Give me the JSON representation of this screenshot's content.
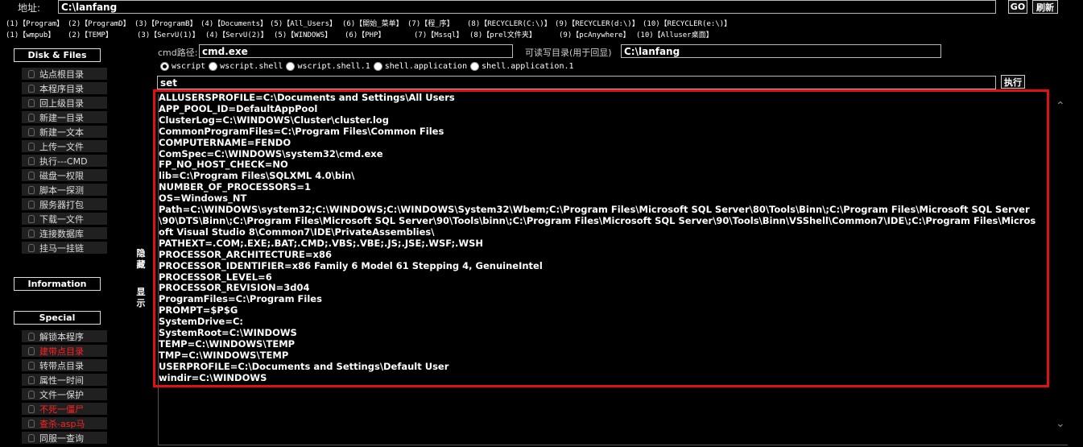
{
  "address": {
    "label": "地址:",
    "value": "C:\\lanfang",
    "go": "GO",
    "refresh": "刷新"
  },
  "quick_links_row1": [
    "(1)【Program】",
    "(2)【ProgramD】",
    "(3)【ProgramB】",
    "(4)【Documents】",
    "(5)【All_Users】",
    "(6)【開始_菜单】",
    "(7)【程_序】",
    "(8)【RECYCLER(C:\\)】",
    "(9)【RECYCLER(d:\\)】",
    "(10)【RECYCLER(e:\\)】"
  ],
  "quick_links_row2": [
    "(1)【wmpub】",
    "(2)【TEMP】",
    "(3)【ServU(1)】",
    "(4)【ServU(2)】",
    "(5)【WINDOWS】",
    "(6)【PHP】",
    "(7)【Mssql】",
    "(8)【prel文件夹】",
    "(9)【pcAnywhere】",
    "(10)【Alluser桌面】"
  ],
  "sidebar": {
    "disk_header": "Disk & Files",
    "disk_items": [
      {
        "label": "站点根目录",
        "red": false
      },
      {
        "label": "本程序目录",
        "red": false
      },
      {
        "label": "回上级目录",
        "red": false
      },
      {
        "label": "新建一目录",
        "red": false
      },
      {
        "label": "新建一文本",
        "red": false
      },
      {
        "label": "上传一文件",
        "red": false
      },
      {
        "label": "执行---CMD",
        "red": false
      },
      {
        "label": "磁盘一权限",
        "red": false
      },
      {
        "label": "脚本一探测",
        "red": false
      },
      {
        "label": "服务器打包",
        "red": false
      },
      {
        "label": "下载一文件",
        "red": false
      },
      {
        "label": "连接数据库",
        "red": false
      },
      {
        "label": "挂马一挂链",
        "red": false
      }
    ],
    "info_header": "Information",
    "special_header": "Special",
    "special_items": [
      {
        "label": "解锁本程序",
        "red": false
      },
      {
        "label": "建带点目录",
        "red": true
      },
      {
        "label": "转带点目录",
        "red": false
      },
      {
        "label": "属性一时间",
        "red": false
      },
      {
        "label": "文件一保护",
        "red": false
      },
      {
        "label": "不死一僵尸",
        "red": true
      },
      {
        "label": "查杀-asp马",
        "red": true
      },
      {
        "label": "同服一查询",
        "red": false
      }
    ],
    "toggle_hide": "隐藏",
    "toggle_show": "显示"
  },
  "cmd": {
    "path_label": "cmd路径:",
    "path_value": "cmd.exe",
    "writable_label": "可读写目录(用于回显)",
    "writable_value": "C:\\lanfang",
    "methods": [
      {
        "label": "wscript",
        "checked": true
      },
      {
        "label": "wscript.shell",
        "checked": false
      },
      {
        "label": "wscript.shell.1",
        "checked": false
      },
      {
        "label": "shell.application",
        "checked": false
      },
      {
        "label": "shell.application.1",
        "checked": false
      }
    ],
    "command_value": "set",
    "execute": "执行"
  },
  "output_lines": [
    "ALLUSERSPROFILE=C:\\Documents and Settings\\All Users",
    "APP_POOL_ID=DefaultAppPool",
    "ClusterLog=C:\\WINDOWS\\Cluster\\cluster.log",
    "CommonProgramFiles=C:\\Program Files\\Common Files",
    "COMPUTERNAME=FENDO",
    "ComSpec=C:\\WINDOWS\\system32\\cmd.exe",
    "FP_NO_HOST_CHECK=NO",
    "lib=C:\\Program Files\\SQLXML 4.0\\bin\\",
    "NUMBER_OF_PROCESSORS=1",
    "OS=Windows_NT",
    "Path=C:\\WINDOWS\\system32;C:\\WINDOWS;C:\\WINDOWS\\System32\\Wbem;C:\\Program Files\\Microsoft SQL Server\\80\\Tools\\Binn\\;C:\\Program Files\\Microsoft SQL Server\\90\\DTS\\Binn\\;C:\\Program Files\\Microsoft SQL Server\\90\\Tools\\binn\\;C:\\Program Files\\Microsoft SQL Server\\90\\Tools\\Binn\\VSShell\\Common7\\IDE\\;C:\\Program Files\\Microsoft Visual Studio 8\\Common7\\IDE\\PrivateAssemblies\\",
    "PATHEXT=.COM;.EXE;.BAT;.CMD;.VBS;.VBE;.JS;.JSE;.WSF;.WSH",
    "PROCESSOR_ARCHITECTURE=x86",
    "PROCESSOR_IDENTIFIER=x86 Family 6 Model 61 Stepping 4, GenuineIntel",
    "PROCESSOR_LEVEL=6",
    "PROCESSOR_REVISION=3d04",
    "ProgramFiles=C:\\Program Files",
    "PROMPT=$P$G",
    "SystemDrive=C:",
    "SystemRoot=C:\\WINDOWS",
    "TEMP=C:\\WINDOWS\\TEMP",
    "TMP=C:\\WINDOWS\\TEMP",
    "USERPROFILE=C:\\Documents and Settings\\Default User",
    "windir=C:\\WINDOWS"
  ],
  "icons": {
    "menu_item": "mouse-icon",
    "scroll_up": "chevron-up-icon",
    "scroll_down": "chevron-down-icon"
  },
  "colors": {
    "highlight_box": "#e21010",
    "red_menu": "#ff2222",
    "background": "#000000"
  }
}
